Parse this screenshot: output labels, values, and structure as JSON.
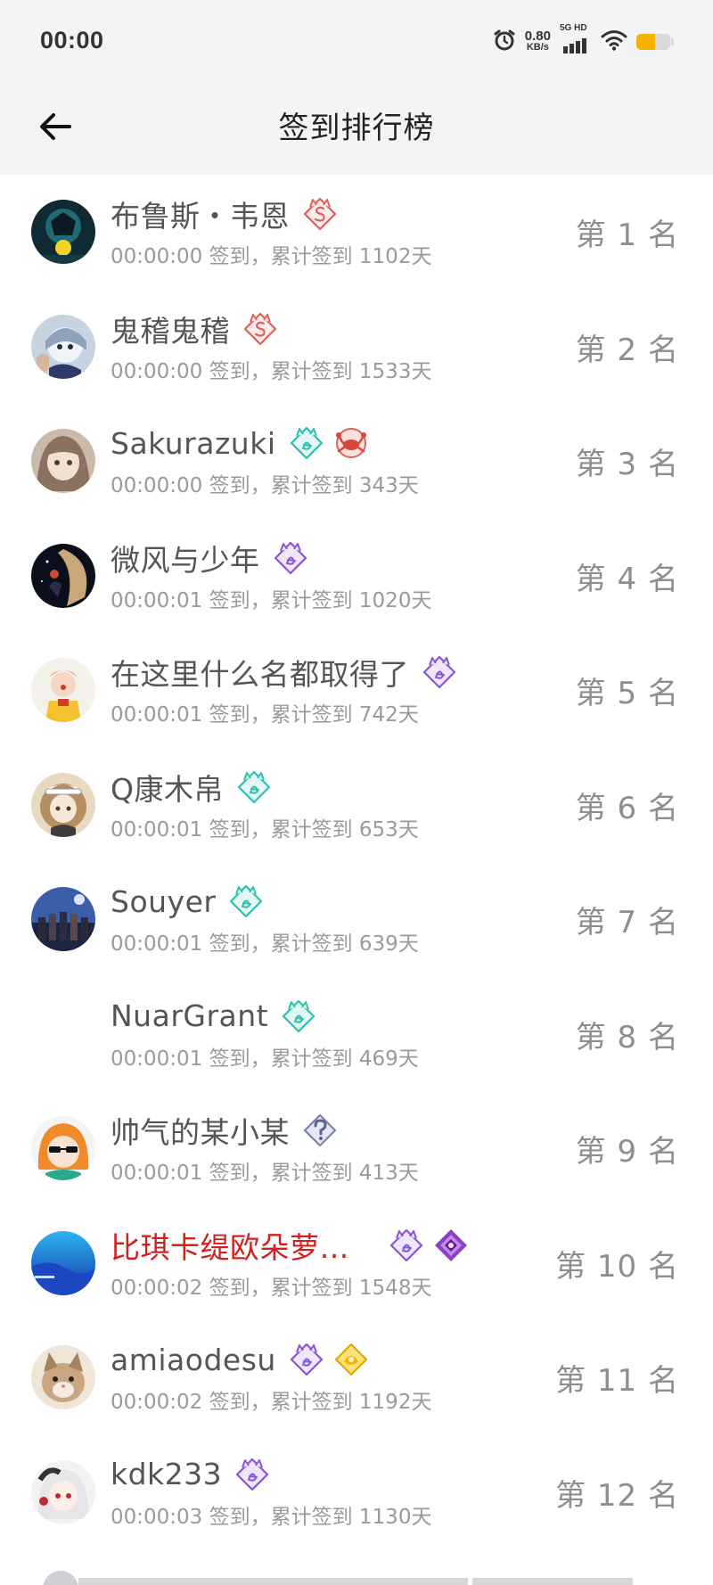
{
  "status_bar": {
    "time": "00:00",
    "speed_value": "0.80",
    "speed_unit": "KB/s",
    "network": "5G HD",
    "icons": [
      "alarm-icon",
      "network-speed",
      "signal-icon",
      "wifi-icon",
      "battery-icon"
    ],
    "battery_level": 0.55,
    "battery_color": "#f6b400"
  },
  "header": {
    "title": "签到排行榜",
    "back_icon": "back-arrow-icon"
  },
  "colors": {
    "header_bg": "#f4f4f4",
    "vip_name": "#d41f1f",
    "badge_teal": "#2fbfb0",
    "badge_purple": "#8a55d6",
    "badge_red": "#e0605a"
  },
  "ranking": [
    {
      "name": "布鲁斯・韦恩",
      "sub": "00:00:00 签到，累计签到 1102天",
      "rank": "第 1 名",
      "vip": false,
      "badges": [
        "s-badge-icon"
      ],
      "avatar": "dark-hero-avatar"
    },
    {
      "name": "鬼稽鬼稽",
      "sub": "00:00:00 签到，累计签到 1533天",
      "rank": "第 2 名",
      "vip": false,
      "badges": [
        "s-badge-icon"
      ],
      "avatar": "doll-avatar"
    },
    {
      "name": "Sakurazuki",
      "sub": "00:00:00 签到，累计签到 343天",
      "rank": "第 3 名",
      "vip": false,
      "badges": [
        "teal-cat-badge-icon",
        "crab-badge-icon"
      ],
      "avatar": "anime-girl-avatar"
    },
    {
      "name": "微风与少年",
      "sub": "00:00:01 签到，累计签到 1020天",
      "rank": "第 4 名",
      "vip": false,
      "badges": [
        "purple-cat-badge-icon"
      ],
      "avatar": "night-scene-avatar"
    },
    {
      "name": "在这里什么名都取得了",
      "sub": "00:00:01 签到，累计签到 742天",
      "rank": "第 5 名",
      "vip": false,
      "badges": [
        "purple-cat-badge-icon"
      ],
      "avatar": "clown-avatar"
    },
    {
      "name": "Q康木帛",
      "sub": "00:00:01 签到，累计签到 653天",
      "rank": "第 6 名",
      "vip": false,
      "badges": [
        "teal-cat-badge-icon"
      ],
      "avatar": "curly-girl-avatar"
    },
    {
      "name": "Souyer",
      "sub": "00:00:01 签到，累计签到 639天",
      "rank": "第 7 名",
      "vip": false,
      "badges": [
        "teal-cat-badge-icon"
      ],
      "avatar": "group-avatar"
    },
    {
      "name": "NuarGrant",
      "sub": "00:00:01 签到，累计签到 469天",
      "rank": "第 8 名",
      "vip": false,
      "badges": [
        "teal-cat-badge-icon"
      ],
      "avatar": "blank-avatar"
    },
    {
      "name": "帅气的某小某",
      "sub": "00:00:01 签到，累计签到 413天",
      "rank": "第 9 名",
      "vip": false,
      "badges": [
        "question-badge-icon"
      ],
      "avatar": "sunglasses-avatar"
    },
    {
      "name": "比琪卡缇欧朵萝…",
      "sub": "00:00:02 签到，累计签到 1548天",
      "rank": "第 10 名",
      "vip": true,
      "badges": [
        "purple-cat-badge-icon",
        "purple-gem-badge-icon"
      ],
      "avatar": "blue-sea-avatar"
    },
    {
      "name": "amiaodesu",
      "sub": "00:00:02 签到，累计签到 1192天",
      "rank": "第 11 名",
      "vip": false,
      "badges": [
        "purple-cat-badge-icon",
        "gold-badge-icon"
      ],
      "avatar": "cat-avatar"
    },
    {
      "name": "kdk233",
      "sub": "00:00:03 签到，累计签到 1130天",
      "rank": "第 12 名",
      "vip": false,
      "badges": [
        "purple-cat-badge-icon"
      ],
      "avatar": "white-hair-avatar"
    }
  ]
}
